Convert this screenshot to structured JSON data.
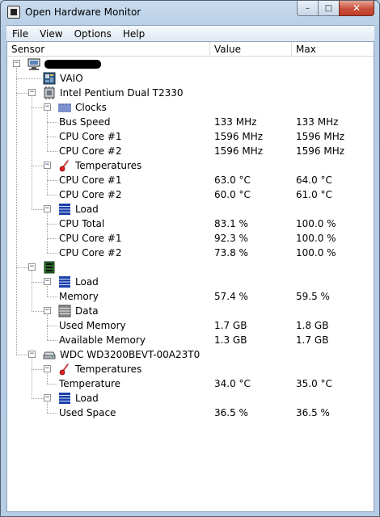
{
  "window": {
    "title": "Open Hardware Monitor",
    "minimize": "–",
    "maximize": "□",
    "close": "✕"
  },
  "menu": [
    "File",
    "View",
    "Options",
    "Help"
  ],
  "columns": [
    "Sensor",
    "Value",
    "Max"
  ],
  "tree": [
    {
      "level": 0,
      "expander": "−",
      "icon": "computer-icon",
      "label": "",
      "redacted": true
    },
    {
      "level": 1,
      "expander": "",
      "icon": "motherboard-icon",
      "label": "VAIO"
    },
    {
      "level": 1,
      "expander": "−",
      "icon": "cpu-icon",
      "label": "Intel Pentium Dual T2330"
    },
    {
      "level": 2,
      "expander": "−",
      "icon": "clock-icon",
      "label": "Clocks"
    },
    {
      "level": 3,
      "expander": "",
      "icon": "",
      "label": "Bus Speed",
      "value": "133 MHz",
      "max": "133 MHz"
    },
    {
      "level": 3,
      "expander": "",
      "icon": "",
      "label": "CPU Core #1",
      "value": "1596 MHz",
      "max": "1596 MHz"
    },
    {
      "level": 3,
      "expander": "",
      "icon": "",
      "label": "CPU Core #2",
      "value": "1596 MHz",
      "max": "1596 MHz"
    },
    {
      "level": 2,
      "expander": "−",
      "icon": "thermometer-icon",
      "label": "Temperatures"
    },
    {
      "level": 3,
      "expander": "",
      "icon": "",
      "label": "CPU Core #1",
      "value": "63.0 °C",
      "max": "64.0 °C"
    },
    {
      "level": 3,
      "expander": "",
      "icon": "",
      "label": "CPU Core #2",
      "value": "60.0 °C",
      "max": "61.0 °C"
    },
    {
      "level": 2,
      "expander": "−",
      "icon": "load-icon",
      "label": "Load"
    },
    {
      "level": 3,
      "expander": "",
      "icon": "",
      "label": "CPU Total",
      "value": "83.1 %",
      "max": "100.0 %"
    },
    {
      "level": 3,
      "expander": "",
      "icon": "",
      "label": "CPU Core #1",
      "value": "92.3 %",
      "max": "100.0 %"
    },
    {
      "level": 3,
      "expander": "",
      "icon": "",
      "label": "CPU Core #2",
      "value": "73.8 %",
      "max": "100.0 %"
    },
    {
      "level": 1,
      "expander": "−",
      "icon": "ram-icon",
      "label": ""
    },
    {
      "level": 2,
      "expander": "−",
      "icon": "load-icon",
      "label": "Load"
    },
    {
      "level": 3,
      "expander": "",
      "icon": "",
      "label": "Memory",
      "value": "57.4 %",
      "max": "59.5 %"
    },
    {
      "level": 2,
      "expander": "−",
      "icon": "data-icon",
      "label": "Data"
    },
    {
      "level": 3,
      "expander": "",
      "icon": "",
      "label": "Used Memory",
      "value": "1.7 GB",
      "max": "1.8 GB"
    },
    {
      "level": 3,
      "expander": "",
      "icon": "",
      "label": "Available Memory",
      "value": "1.3 GB",
      "max": "1.7 GB"
    },
    {
      "level": 1,
      "expander": "−",
      "icon": "hdd-icon",
      "label": "WDC WD3200BEVT-00A23T0"
    },
    {
      "level": 2,
      "expander": "−",
      "icon": "thermometer-icon",
      "label": "Temperatures"
    },
    {
      "level": 3,
      "expander": "",
      "icon": "",
      "label": "Temperature",
      "value": "34.0 °C",
      "max": "35.0 °C"
    },
    {
      "level": 2,
      "expander": "−",
      "icon": "load-icon",
      "label": "Load"
    },
    {
      "level": 3,
      "expander": "",
      "icon": "",
      "label": "Used Space",
      "value": "36.5 %",
      "max": "36.5 %"
    }
  ]
}
